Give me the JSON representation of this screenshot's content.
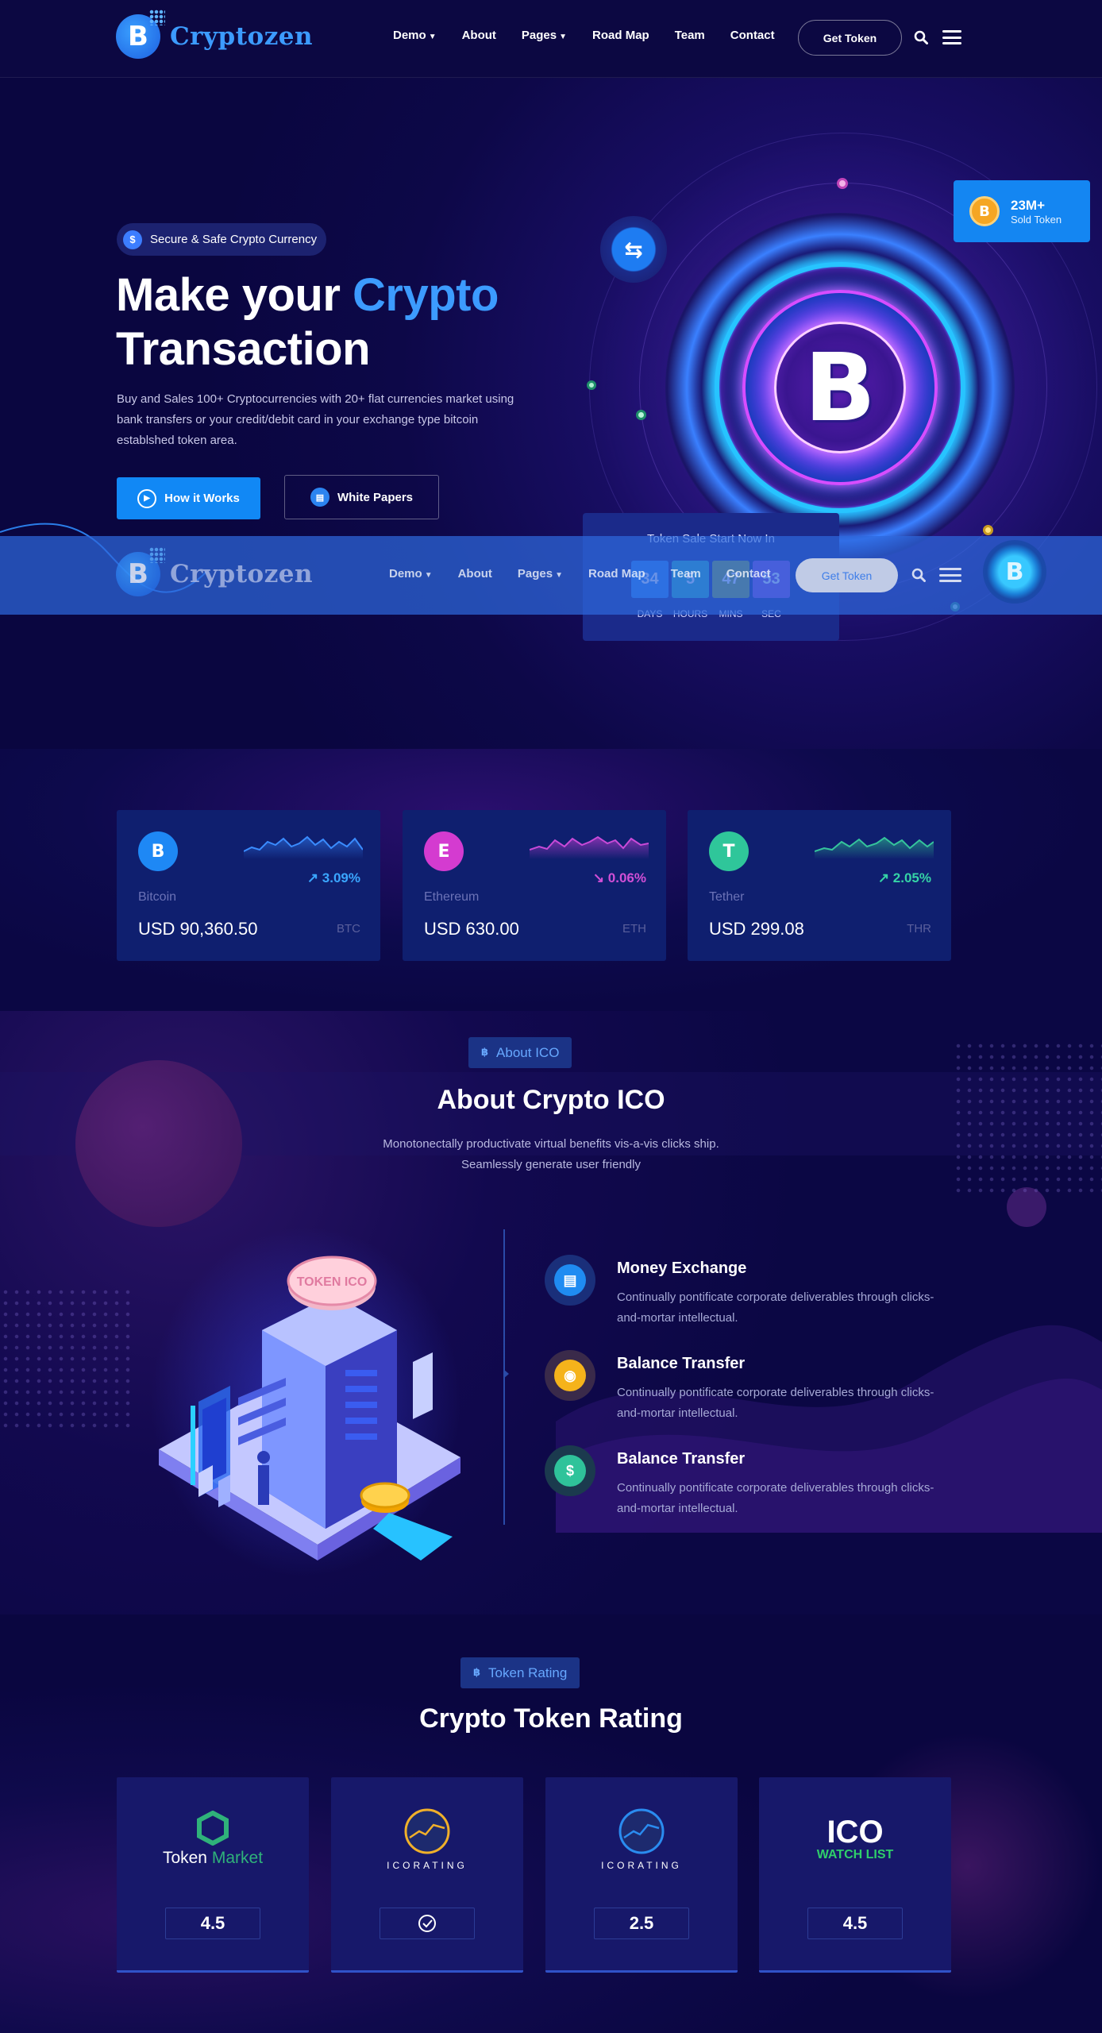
{
  "header": {
    "brand": "Cryptozen",
    "logo_letter": "B",
    "nav": [
      {
        "label": "Demo",
        "dropdown": true
      },
      {
        "label": "About",
        "dropdown": false
      },
      {
        "label": "Pages",
        "dropdown": true
      },
      {
        "label": "Road Map",
        "dropdown": false
      },
      {
        "label": "Team",
        "dropdown": false
      },
      {
        "label": "Contact",
        "dropdown": false
      }
    ],
    "cta": "Get Token",
    "icons": [
      "search-icon",
      "hamburger-menu-icon"
    ]
  },
  "hero": {
    "badge": "Secure & Safe Crypto Currency",
    "badge_icon": "$",
    "title_part1": "Make your ",
    "title_accent": "Crypto",
    "title_part2": "Transaction",
    "description": "Buy and Sales 100+ Cryptocurrencies with 20+ flat currencies market using bank transfers or your credit/debit card in your exchange type bitcoin establshed token area.",
    "btn_primary": "How it Works",
    "btn_secondary": "White Papers",
    "coin_symbol": "B",
    "sold": {
      "value": "23M+",
      "label": "Sold Token",
      "coin": "B"
    },
    "countdown": {
      "title": "Token Sale Start Now In",
      "units": [
        {
          "value": "34",
          "label": "DAYS",
          "color": "#2e86f0"
        },
        {
          "value": "5",
          "label": "HOURS",
          "color": "#2bb3b8"
        },
        {
          "value": "47",
          "label": "MINS",
          "color": "#8aa53c"
        },
        {
          "value": "53",
          "label": "SEC",
          "color": "#8a4ad8"
        }
      ]
    }
  },
  "sticky_header": {
    "brand": "Cryptozen",
    "cta": "Get Token"
  },
  "prices": [
    {
      "name": "Bitcoin",
      "price": "USD 90,360.50",
      "code": "BTC",
      "change": "3.09%",
      "trend": "up",
      "icon_color": "#1e88f5",
      "accent": "#3aa6ff",
      "glyph": "B"
    },
    {
      "name": "Ethereum",
      "price": "USD 630.00",
      "code": "ETH",
      "change": "0.06%",
      "trend": "down",
      "icon_color": "#d43bd0",
      "accent": "#d14fd6",
      "glyph": "E"
    },
    {
      "name": "Tether",
      "price": "USD 299.08",
      "code": "THR",
      "change": "2.05%",
      "trend": "up",
      "icon_color": "#2fc69a",
      "accent": "#35d3a6",
      "glyph": "T"
    }
  ],
  "about": {
    "label": "About ICO",
    "title": "About Crypto ICO",
    "description": "Monotonectally productivate virtual benefits vis-a-vis clicks ship. Seamlessly generate user friendly",
    "illustration_sign": "TOKEN ICO",
    "features": [
      {
        "title": "Money Exchange",
        "description": "Continually pontificate corporate deliverables through clicks-and-mortar intellectual.",
        "color": "#1f8cf2",
        "ring": "#1a2f7a",
        "icon": "money-exchange-icon"
      },
      {
        "title": "Balance Transfer",
        "description": "Continually pontificate corporate deliverables through clicks-and-mortar intellectual.",
        "color": "#f5b31b",
        "ring": "#3a2a4a",
        "icon": "coin-transfer-icon"
      },
      {
        "title": "Balance Transfer",
        "description": "Continually pontificate corporate deliverables through clicks-and-mortar intellectual.",
        "color": "#2fc39a",
        "ring": "#1b3a4e",
        "icon": "money-bag-icon"
      }
    ]
  },
  "rating": {
    "label": "Token Rating",
    "title": "Crypto Token Rating",
    "cards": [
      {
        "brand_a": "Token",
        "brand_b": "Market",
        "score": "4.5",
        "logo": "token-market-logo"
      },
      {
        "brand_a": "ICORATING",
        "brand_b": "",
        "score": "",
        "logo": "icorating-gold-logo",
        "check": true
      },
      {
        "brand_a": "ICORATING",
        "brand_b": "",
        "score": "2.5",
        "logo": "icorating-blue-logo"
      },
      {
        "brand_a": "ICO",
        "brand_b": "WATCH LIST",
        "score": "4.5",
        "logo": "ico-watchlist-logo"
      }
    ]
  }
}
